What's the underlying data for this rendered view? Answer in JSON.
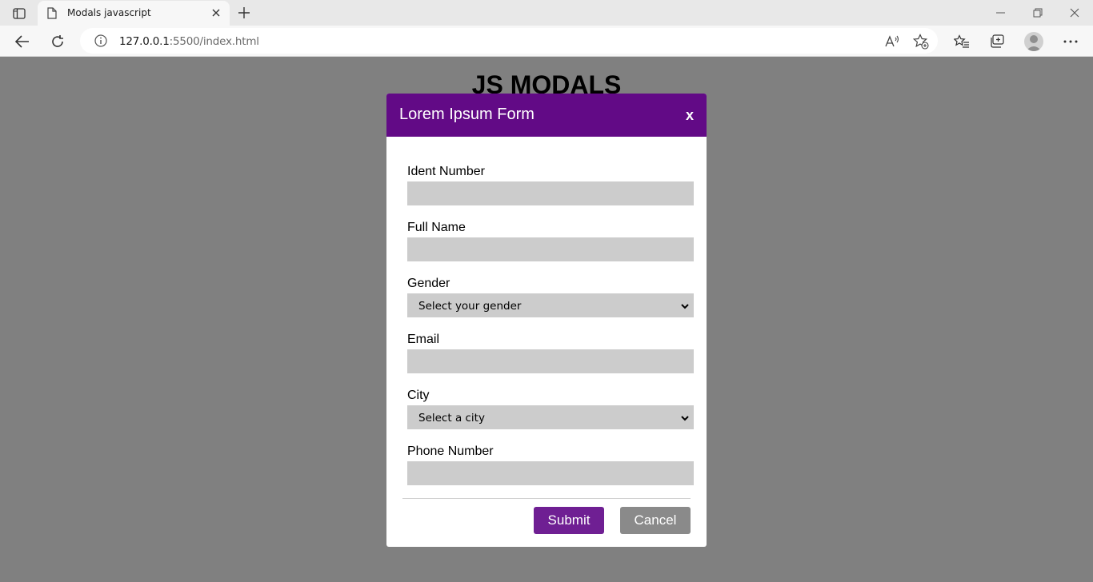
{
  "browser": {
    "tab_title": "Modals javascript",
    "url_host": "127.0.0.1",
    "url_rest": ":5500/index.html",
    "read_aloud_label": "A⁾"
  },
  "page": {
    "heading": "JS MODALS"
  },
  "modal": {
    "title": "Lorem Ipsum Form",
    "close_label": "x",
    "fields": {
      "ident": {
        "label": "Ident Number",
        "value": ""
      },
      "fullname": {
        "label": "Full Name",
        "value": ""
      },
      "gender": {
        "label": "Gender",
        "selected": "Select your gender"
      },
      "email": {
        "label": "Email",
        "value": ""
      },
      "city": {
        "label": "City",
        "selected": "Select a city"
      },
      "phone": {
        "label": "Phone Number",
        "value": ""
      }
    },
    "submit_label": "Submit",
    "cancel_label": "Cancel"
  },
  "colors": {
    "modal_header": "#620a86",
    "submit_button": "#6f1f93",
    "cancel_button": "#8a8a8a",
    "input_background": "#cccccc",
    "overlay": "#808080"
  }
}
